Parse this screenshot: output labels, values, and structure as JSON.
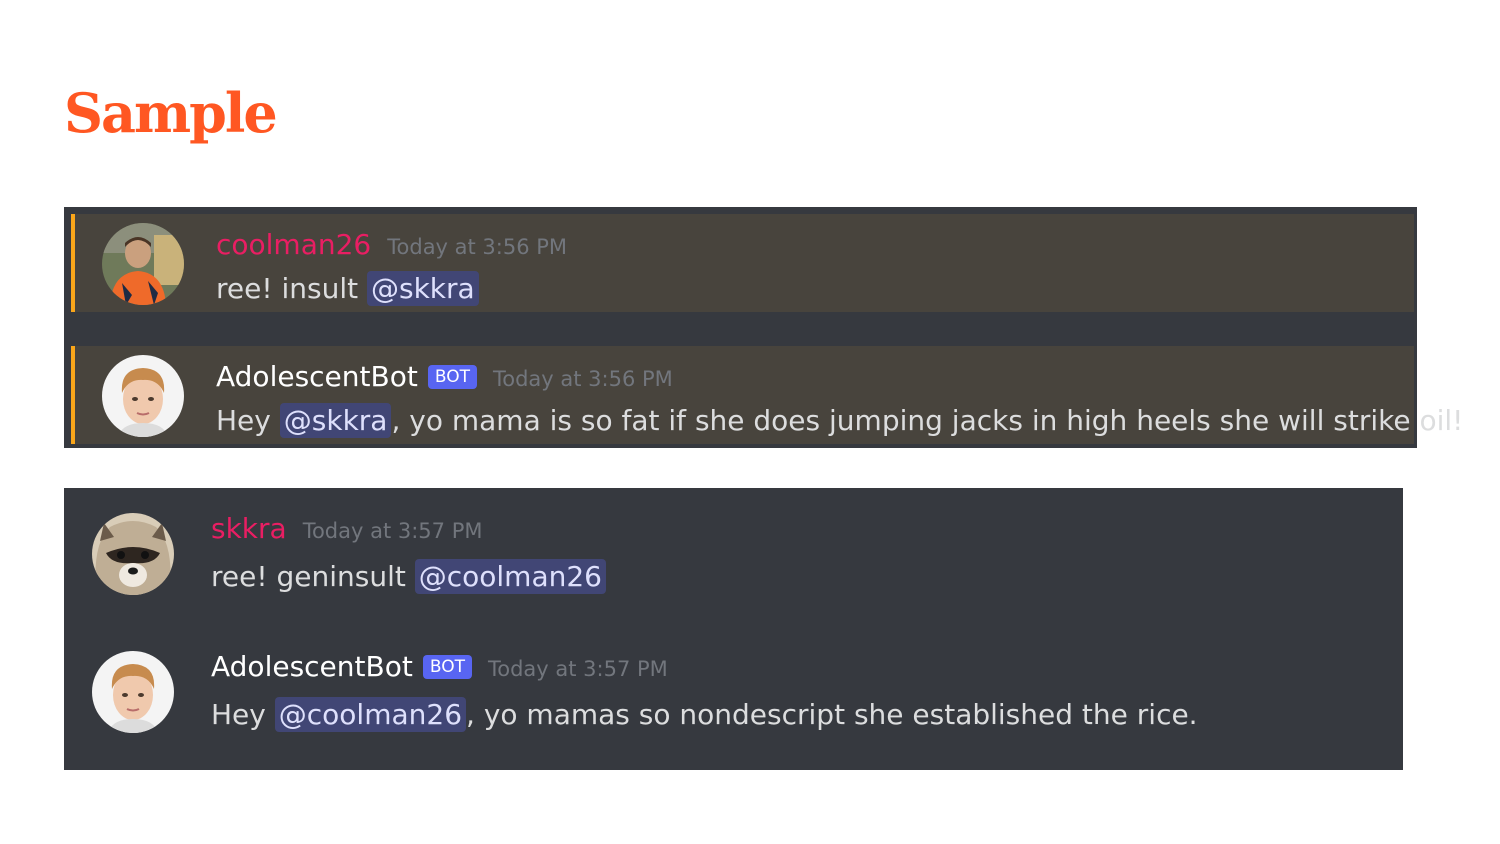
{
  "slide": {
    "title": "Sample"
  },
  "colors": {
    "title": "#FF5722",
    "panel_bg": "#36393f",
    "highlight_bg": "#48443d",
    "highlight_bar": "#faa61a",
    "username_pink": "#e91e63",
    "bot_badge": "#5865f2",
    "mention_bg": "#414675",
    "timestamp": "#72767d"
  },
  "messages": [
    {
      "author": "coolman26",
      "timestamp": "Today at 3:56 PM",
      "text_before": "ree! insult ",
      "mention": "@skkra",
      "text_after": "",
      "avatar": "boy-orange-shirt-avatar",
      "highlighted": true
    },
    {
      "author": "AdolescentBot",
      "badge": "BOT",
      "timestamp": "Today at 3:56 PM",
      "text_before": "Hey ",
      "mention": "@skkra",
      "text_after": ", yo mama is so fat if she does jumping jacks in high heels she will strike oil!",
      "avatar": "blond-boy-avatar",
      "highlighted": true
    },
    {
      "author": "skkra",
      "timestamp": "Today at 3:57 PM",
      "text_before": "ree! geninsult ",
      "mention": "@coolman26",
      "text_after": "",
      "avatar": "raccoon-avatar",
      "highlighted": false
    },
    {
      "author": "AdolescentBot",
      "badge": "BOT",
      "timestamp": "Today at 3:57 PM",
      "text_before": "Hey ",
      "mention": "@coolman26",
      "text_after": ", yo mamas so nondescript she established the rice.",
      "avatar": "blond-boy-avatar",
      "highlighted": false
    }
  ]
}
